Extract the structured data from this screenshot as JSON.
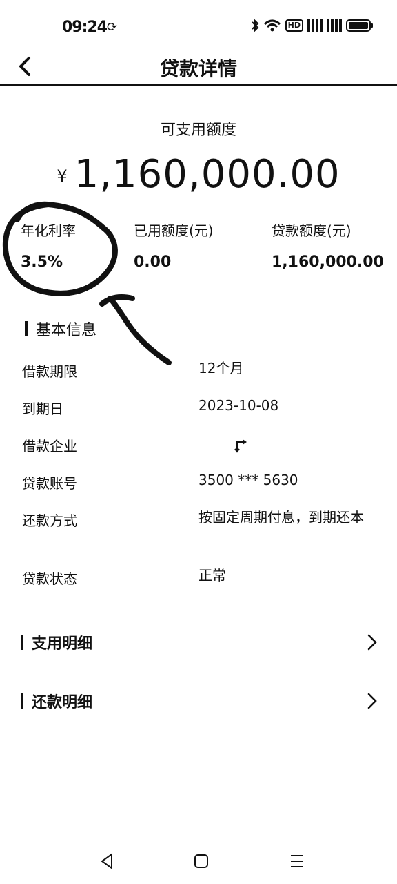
{
  "status": {
    "time": "09:24",
    "network_badge": "HD"
  },
  "nav": {
    "title": "贷款详情"
  },
  "summary": {
    "label": "可支用额度",
    "currency": "¥",
    "amount": "1,160,000.00"
  },
  "stats": [
    {
      "label": "年化利率",
      "value": "3.5%"
    },
    {
      "label": "已用额度(元)",
      "value": "0.00"
    },
    {
      "label": "贷款额度(元)",
      "value": "1,160,000.00"
    }
  ],
  "basic_info": {
    "heading": "基本信息",
    "rows": [
      {
        "key": "借款期限",
        "value": "12个月"
      },
      {
        "key": "到期日",
        "value": "2023-10-08"
      },
      {
        "key": "借款企业",
        "value": ""
      },
      {
        "key": "贷款账号",
        "value": "3500 *** 5630"
      },
      {
        "key": "还款方式",
        "value": "按固定周期付息，到期还本"
      },
      {
        "key": "贷款状态",
        "value": "正常"
      }
    ]
  },
  "links": {
    "usage_detail": "支用明细",
    "repayment_detail": "还款明细"
  },
  "icons": {
    "back": "chevron-left-icon",
    "chevron": "chevron-right-icon",
    "sync": "sync-icon",
    "bluetooth": "bluetooth-icon",
    "wifi": "wifi-icon",
    "battery": "battery-icon"
  },
  "colors": {
    "text": "#111111",
    "background": "#ffffff"
  }
}
